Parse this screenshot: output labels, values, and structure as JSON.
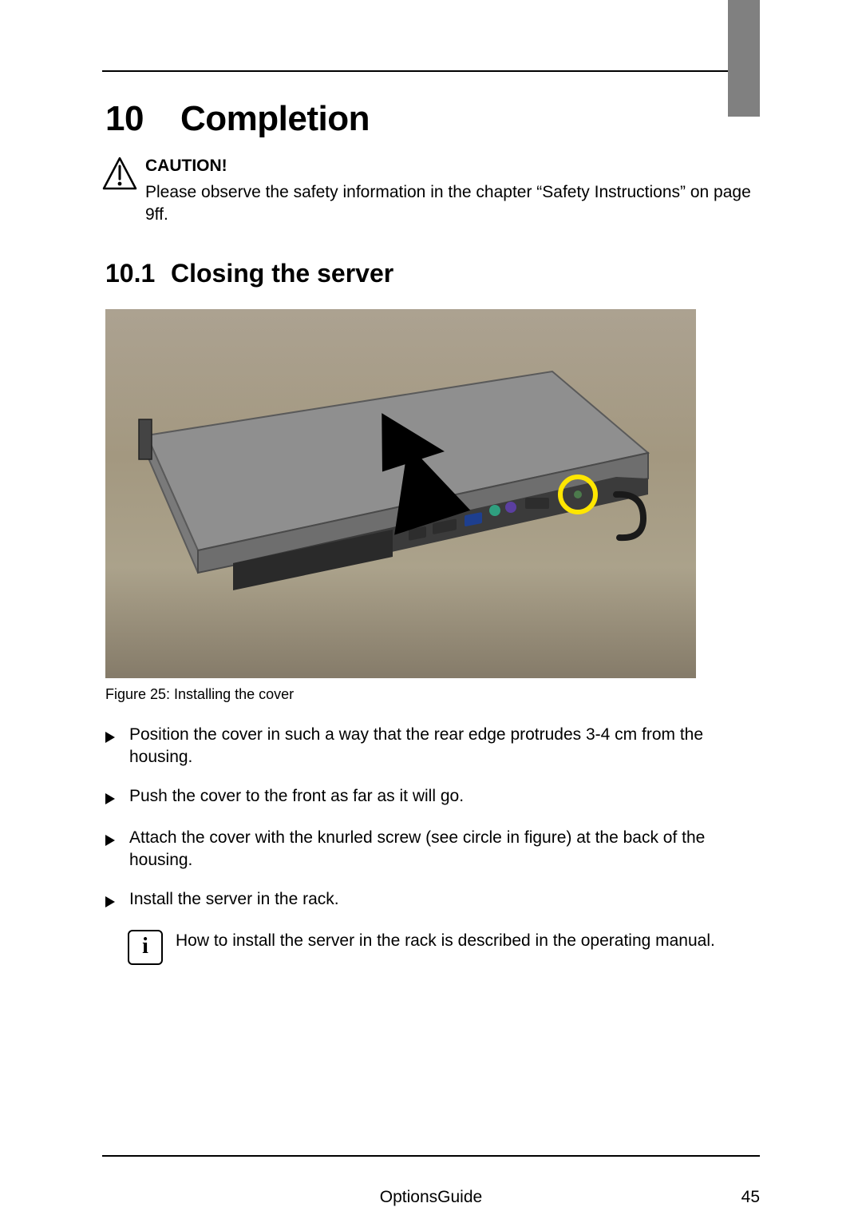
{
  "chapter": {
    "number": "10",
    "title": "Completion"
  },
  "caution": {
    "label": "CAUTION!",
    "text": "Please observe the safety information in the chapter “Safety Instructions” on page 9ff."
  },
  "section": {
    "number": "10.1",
    "title": "Closing the server"
  },
  "figure": {
    "caption": "Figure 25: Installing the cover"
  },
  "steps": [
    "Position the cover in such a way that the rear edge protrudes 3-4 cm from the housing.",
    "Push the cover to the front as far as it will go.",
    "Attach the cover with the knurled screw (see circle in figure) at the back of the housing.",
    "Install the server in the rack."
  ],
  "info": "How to install the server in the rack is described in the operating manual.",
  "footer": {
    "center": "OptionsGuide",
    "page": "45"
  },
  "icons": {
    "info_glyph": "i"
  }
}
